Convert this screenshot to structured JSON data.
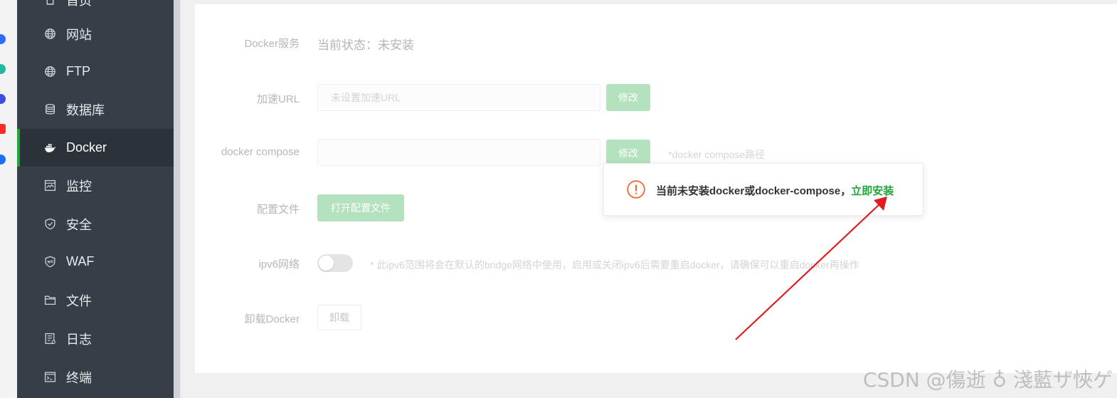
{
  "sidebar": {
    "items": [
      {
        "label": "首页",
        "icon": "home-icon"
      },
      {
        "label": "网站",
        "icon": "globe-icon"
      },
      {
        "label": "FTP",
        "icon": "globe-icon"
      },
      {
        "label": "数据库",
        "icon": "database-icon"
      },
      {
        "label": "Docker",
        "icon": "docker-icon",
        "active": true
      },
      {
        "label": "监控",
        "icon": "monitor-icon"
      },
      {
        "label": "安全",
        "icon": "shield-icon"
      },
      {
        "label": "WAF",
        "icon": "waf-shield-icon"
      },
      {
        "label": "文件",
        "icon": "folder-icon"
      },
      {
        "label": "日志",
        "icon": "log-icon"
      },
      {
        "label": "终端",
        "icon": "terminal-icon"
      }
    ]
  },
  "settings": {
    "docker_service": {
      "label": "Docker服务",
      "status": "当前状态：未安装"
    },
    "mirror_url": {
      "label": "加速URL",
      "placeholder": "未设置加速URL",
      "button": "修改"
    },
    "compose": {
      "label": "docker compose",
      "value": "",
      "button": "修改",
      "hint": "*docker compose路径"
    },
    "config_file": {
      "label": "配置文件",
      "button": "打开配置文件"
    },
    "ipv6": {
      "label": "ipv6网络",
      "enabled": false,
      "hint": "* 此ipv6范围将会在默认的bridge网络中使用，启用或关闭ipv6后需要重启docker，请确保可以重启docker再操作"
    },
    "uninstall": {
      "label": "卸载Docker",
      "button": "卸载"
    }
  },
  "popup": {
    "message": "当前未安装docker或docker-compose，",
    "link": "立即安装"
  },
  "colors": {
    "accent": "#20a53a",
    "sidebar_bg": "#363e47",
    "warning": "#f0692c",
    "annotation_arrow": "#e01c1c"
  },
  "watermark": "CSDN @傷逝 ♁ 淺藍ザ悏ゲ"
}
